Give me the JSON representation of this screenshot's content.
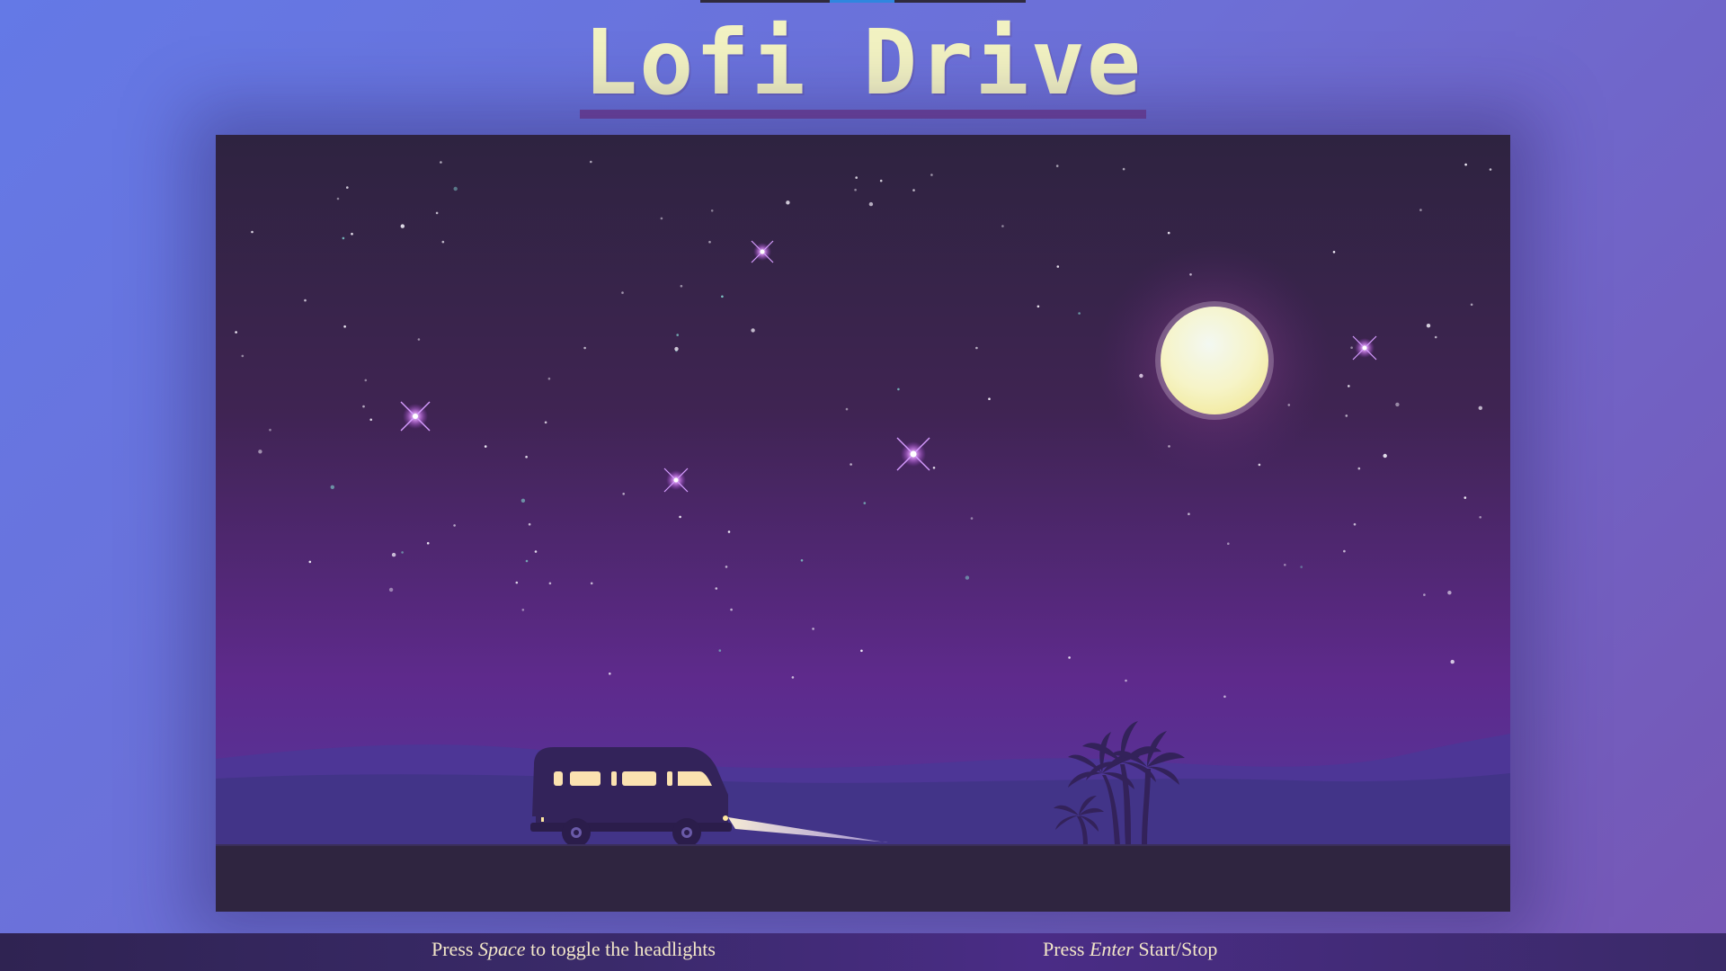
{
  "app": {
    "title": "Lofi Drive"
  },
  "progress": {
    "fraction": 0.2
  },
  "scene": {
    "moon_color": "#fbfbd8",
    "sky_top": "#2e2340",
    "sky_bottom": "#5c2a8a",
    "ground_color": "#2f2540",
    "van_color": "#33235a",
    "headlights_on": true
  },
  "controls": {
    "headlights": {
      "prefix": "Press",
      "key": "Space",
      "suffix": "to toggle the headlights"
    },
    "startstop": {
      "prefix": "Press",
      "key": "Enter",
      "suffix": "Start/Stop"
    }
  },
  "colors": {
    "accent": "#f2f2c2",
    "underline": "#6e45a0",
    "footer_text": "#f2e6c8"
  }
}
